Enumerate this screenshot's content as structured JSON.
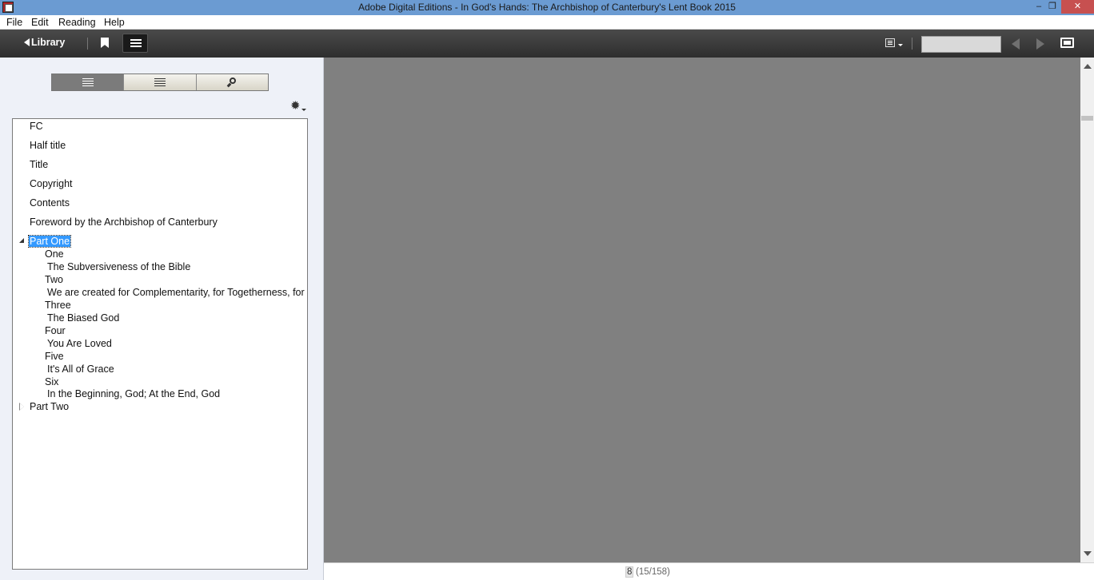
{
  "window": {
    "title": "Adobe Digital Editions - In God's Hands: The Archbishop of Canterbury's Lent Book 2015",
    "minimize": "–",
    "restore": "❐",
    "close": "✕"
  },
  "menu": [
    "File",
    "Edit",
    "Reading",
    "Help"
  ],
  "toolbar": {
    "library_label": "Library",
    "page_input_value": ""
  },
  "toc": {
    "top_items": [
      "FC",
      "Half title",
      "Title",
      "Copyright",
      "Contents",
      "Foreword by the Archbishop of Canterbury"
    ],
    "part_one": {
      "label": "Part One",
      "children": [
        {
          "number": "One",
          "title": "The Subversiveness of the Bible"
        },
        {
          "number": "Two",
          "title": "We are created for Complementarity, for Togetherness, for Family"
        },
        {
          "number": "Three",
          "title": "The Biased God"
        },
        {
          "number": "Four",
          "title": "You Are Loved"
        },
        {
          "number": "Five",
          "title": "It's All of Grace"
        },
        {
          "number": "Six",
          "title": "In the Beginning, God; At the End, God"
        }
      ]
    },
    "part_two": {
      "label": "Part Two"
    }
  },
  "status": {
    "current_page": "8",
    "page_range": "(15/158)"
  },
  "colors": {
    "titlebar": "#6b9bd2",
    "selection": "#3399ff",
    "reading_bg": "#808080"
  }
}
